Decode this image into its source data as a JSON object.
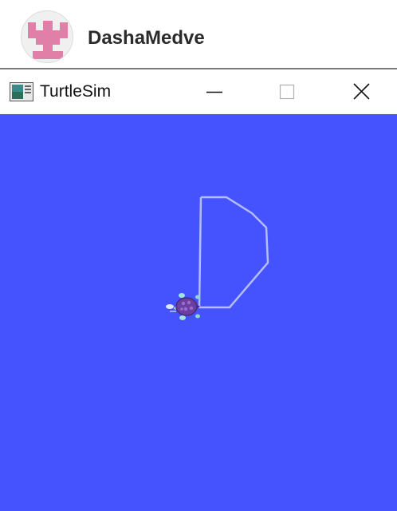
{
  "profile": {
    "username": "DashaMedve",
    "avatar_colors": {
      "background": "#f0f0f0",
      "glyph": "#e07fa8"
    }
  },
  "window": {
    "title": "TurtleSim",
    "icon": "turtlesim-app-icon",
    "controls": [
      "minimize-icon",
      "maximize-icon",
      "close-icon"
    ]
  },
  "turtlesim": {
    "background_color": "#4553ff",
    "pen_color": "#b3bcff",
    "pen_path_shape": "letter-D",
    "turtle": {
      "icon": "turtle-icon",
      "shell_color": "#6a3fa0"
    }
  }
}
